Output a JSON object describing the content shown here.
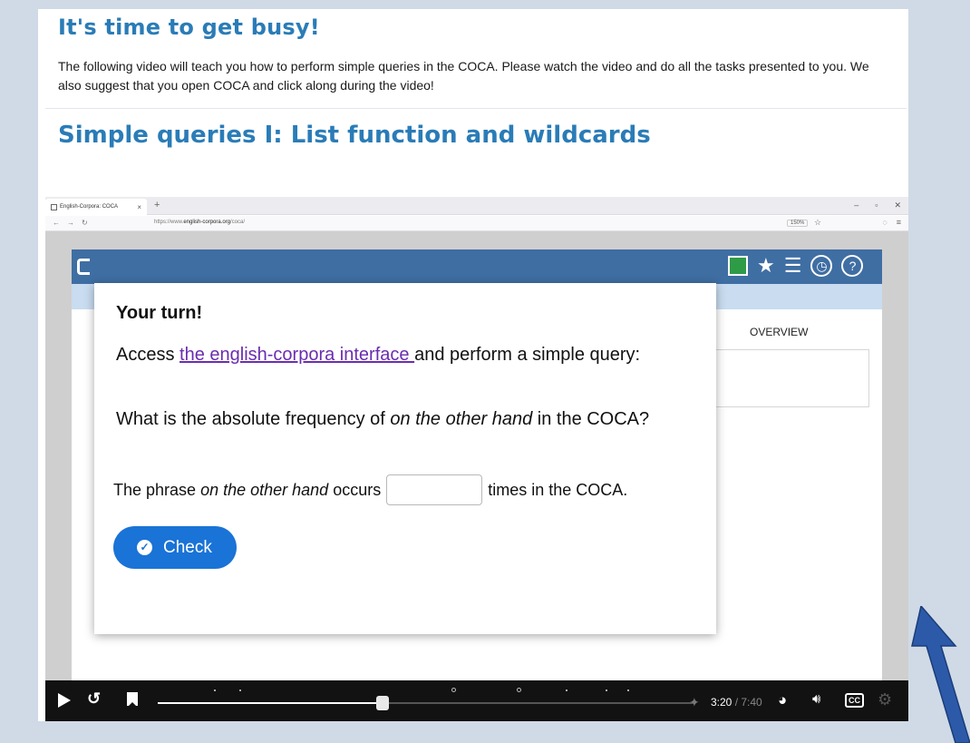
{
  "page": {
    "heading1": "It's time to get busy!",
    "intro": "The following video will teach you how to perform simple queries in the COCA. Please watch the video and do all the tasks presented to you. We also suggest that you open COCA and click along during the video!",
    "heading2": "Simple queries I: List function and wildcards"
  },
  "browser": {
    "tab_title": "English-Corpora: COCA",
    "tab_close": "×",
    "new_tab": "+",
    "url_prefix": "https://www.",
    "url_domain": "english-corpora.org",
    "url_path": "/coca/",
    "zoom": "150%"
  },
  "site": {
    "overview_label": "OVERVIEW"
  },
  "dialog": {
    "title": "Your turn!",
    "access_text": "Access ",
    "link_text": "the english-corpora interface ",
    "access_text_after": "and perform a simple query:",
    "question_pre": "What is the absolute frequency of ",
    "question_em": "on the other hand",
    "question_post": " in the COCA?",
    "answer_pre": "The phrase ",
    "answer_em": "on the other hand",
    "answer_mid": " occurs",
    "answer_post": "times in the COCA.",
    "answer_value": "",
    "check_label": "Check"
  },
  "player": {
    "current_time": "3:20",
    "separator": " / ",
    "duration": "7:40",
    "progress": 0.42,
    "cc_label": "CC"
  },
  "colors": {
    "heading": "#2a7cb7",
    "button": "#1a73d6",
    "link": "#6a2db0"
  }
}
